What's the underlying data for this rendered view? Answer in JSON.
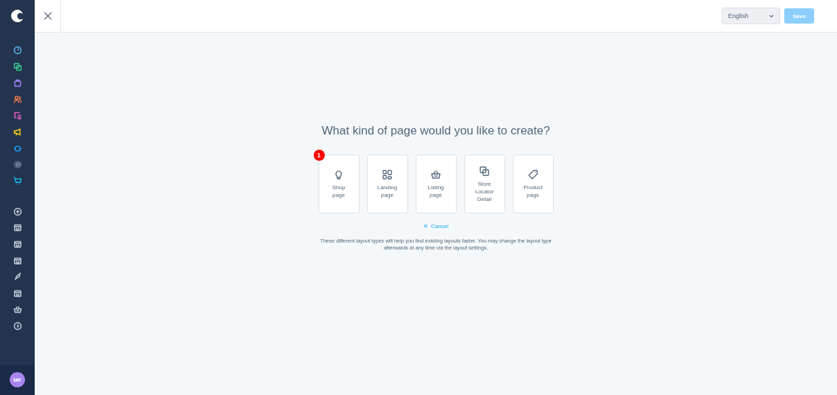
{
  "sidebar": {
    "items": [
      {
        "kind": "gauge",
        "color": "#57b3e8"
      },
      {
        "kind": "copy",
        "color": "#37c28c"
      },
      {
        "kind": "bag",
        "color": "#9c7ff0"
      },
      {
        "kind": "users",
        "color": "#f07c4f"
      },
      {
        "kind": "list",
        "color": "#e85ac6"
      },
      {
        "kind": "megaphone",
        "color": "#f2c81c"
      },
      {
        "kind": "plug",
        "color": "#1e9cf0"
      },
      {
        "kind": "gear",
        "color": "#8a9bb5"
      },
      {
        "kind": "cart",
        "color": "#1ab3e8"
      }
    ],
    "apps": [
      {
        "kind": "plus"
      },
      {
        "kind": "store"
      },
      {
        "kind": "store"
      },
      {
        "kind": "store"
      },
      {
        "kind": "rocket"
      },
      {
        "kind": "store"
      },
      {
        "kind": "basket"
      },
      {
        "kind": "chevron"
      }
    ],
    "avatar": "MF"
  },
  "topbar": {
    "language": "English",
    "save": {
      "label": "Save",
      "disabled": true
    }
  },
  "title": "What kind of page would you like to create?",
  "page_types": [
    {
      "kind": "bulb",
      "label": "Shop page",
      "badge": "1"
    },
    {
      "kind": "grid",
      "label": "Landing page"
    },
    {
      "kind": "basket",
      "label": "Listing page"
    },
    {
      "kind": "copy",
      "label": "Store Locator Detail"
    },
    {
      "kind": "tag",
      "label": "Product page"
    }
  ],
  "cancel": {
    "icon": "✕",
    "label": "Cancel"
  },
  "hint": "These different layout types will help you find existing layouts faster. You may change the layout type afterwards at any time via the layout settings."
}
